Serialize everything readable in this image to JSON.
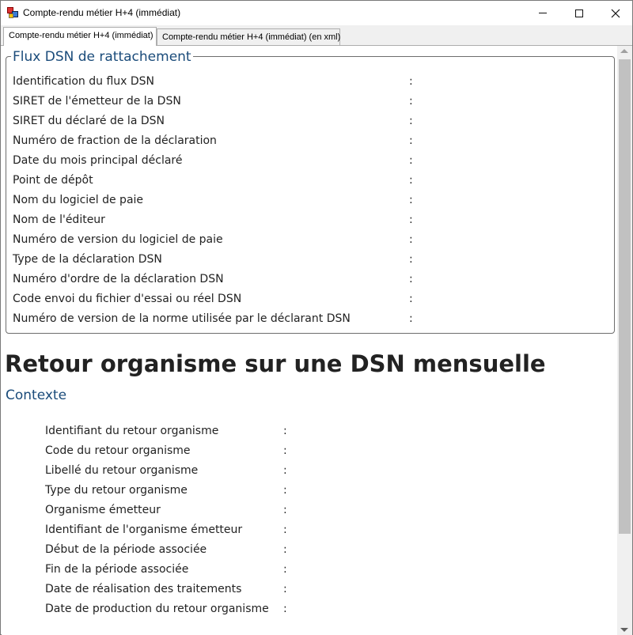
{
  "window": {
    "title": "Compte-rendu métier H+4 (immédiat)",
    "icons": {
      "app": "app-icon",
      "minimize": "minimize-icon",
      "maximize": "maximize-icon",
      "close": "close-icon"
    }
  },
  "tabs": [
    {
      "label": "Compte-rendu métier H+4 (immédiat)",
      "active": true
    },
    {
      "label": "Compte-rendu métier H+4 (immédiat) (en xml)",
      "active": false
    }
  ],
  "flux": {
    "legend": "Flux DSN de rattachement",
    "rows": [
      {
        "label": "Identification du flux DSN",
        "sep": ":"
      },
      {
        "label": "SIRET de l'émetteur de la DSN",
        "sep": ":"
      },
      {
        "label": "SIRET du déclaré de la DSN",
        "sep": ":"
      },
      {
        "label": "Numéro de fraction de la déclaration",
        "sep": ":"
      },
      {
        "label": "Date du mois principal déclaré",
        "sep": ":"
      },
      {
        "label": "Point de dépôt",
        "sep": ":"
      },
      {
        "label": "Nom du logiciel de paie",
        "sep": ":"
      },
      {
        "label": "Nom de l'éditeur",
        "sep": ":"
      },
      {
        "label": "Numéro de version du logiciel de paie",
        "sep": ":"
      },
      {
        "label": "Type de la déclaration DSN",
        "sep": ":"
      },
      {
        "label": "Numéro d'ordre de la déclaration DSN",
        "sep": ":"
      },
      {
        "label": "Code envoi du fichier d'essai ou réel DSN",
        "sep": ":"
      },
      {
        "label": "Numéro de version de la norme utilisée par le déclarant DSN",
        "sep": ":"
      }
    ]
  },
  "retour": {
    "heading": "Retour organisme sur une DSN mensuelle",
    "subheading": "Contexte",
    "rows": [
      {
        "label": "Identifiant du retour organisme",
        "sep": ":"
      },
      {
        "label": "Code du retour organisme",
        "sep": ":"
      },
      {
        "label": "Libellé du retour organisme",
        "sep": ":"
      },
      {
        "label": "Type du retour organisme",
        "sep": ":"
      },
      {
        "label": "Organisme émetteur",
        "sep": ":"
      },
      {
        "label": "Identifiant de l'organisme émetteur",
        "sep": ":"
      },
      {
        "label": "Début de la période associée",
        "sep": ":"
      },
      {
        "label": "Fin de la période associée",
        "sep": ":"
      },
      {
        "label": "Date de réalisation des traitements",
        "sep": ":"
      },
      {
        "label": "Date de production du retour organisme",
        "sep": ":"
      }
    ]
  },
  "colors": {
    "heading_blue": "#1a4b7a",
    "text": "#222222"
  }
}
